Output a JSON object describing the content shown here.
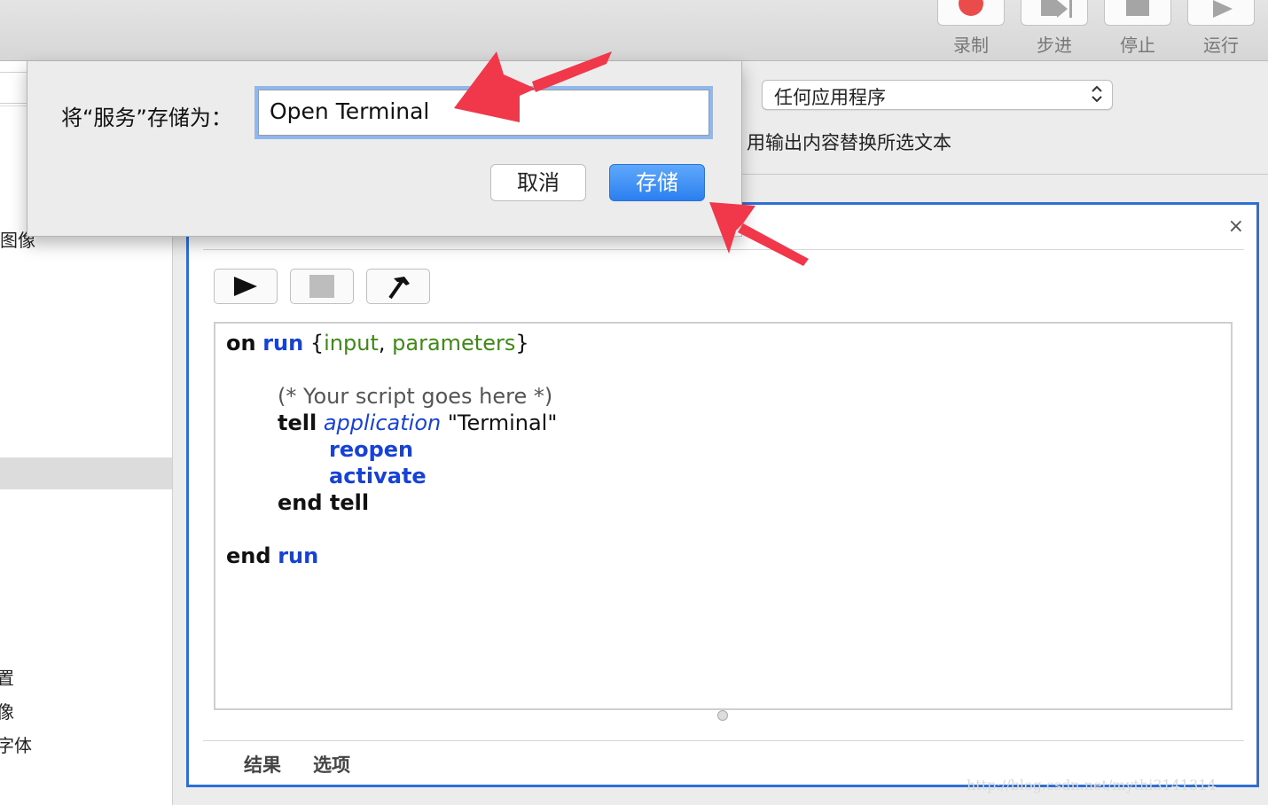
{
  "toolbar": {
    "buttons": [
      {
        "label": "录制",
        "icon": "record-icon"
      },
      {
        "label": "步进",
        "icon": "step-icon"
      },
      {
        "label": "停止",
        "icon": "stop-icon"
      },
      {
        "label": "运行",
        "icon": "run-icon"
      }
    ]
  },
  "sidebar": {
    "items": [
      "图像",
      "置",
      "像",
      "字体"
    ]
  },
  "service_header": {
    "colon": ":",
    "app_popup_value": "任何应用程序",
    "replace_option_text": "用输出内容替换所选文本"
  },
  "save_sheet": {
    "prompt": "将“服务”存储为：",
    "field_value": "Open Terminal",
    "cancel_label": "取消",
    "save_label": "存储"
  },
  "action_panel": {
    "close_glyph": "×",
    "code": {
      "l1": {
        "a": "on",
        "b": "run",
        "c": " {",
        "d": "input",
        "e": ", ",
        "f": "parameters",
        "g": "}"
      },
      "l2": "(* Your script goes here *)",
      "l3": {
        "a": "tell",
        "b": "application",
        "c": " \"Terminal\""
      },
      "l4": "reopen",
      "l5": "activate",
      "l6": "end tell",
      "l7": {
        "a": "end",
        "b": "run"
      }
    },
    "tabs": [
      "结果",
      "选项"
    ]
  },
  "watermark": "http://blog.csdn.net/mythi3141314",
  "colors": {
    "accent": "#2e6fd6",
    "save_button": "#3a8ef6",
    "arrow": "#f0384a"
  }
}
